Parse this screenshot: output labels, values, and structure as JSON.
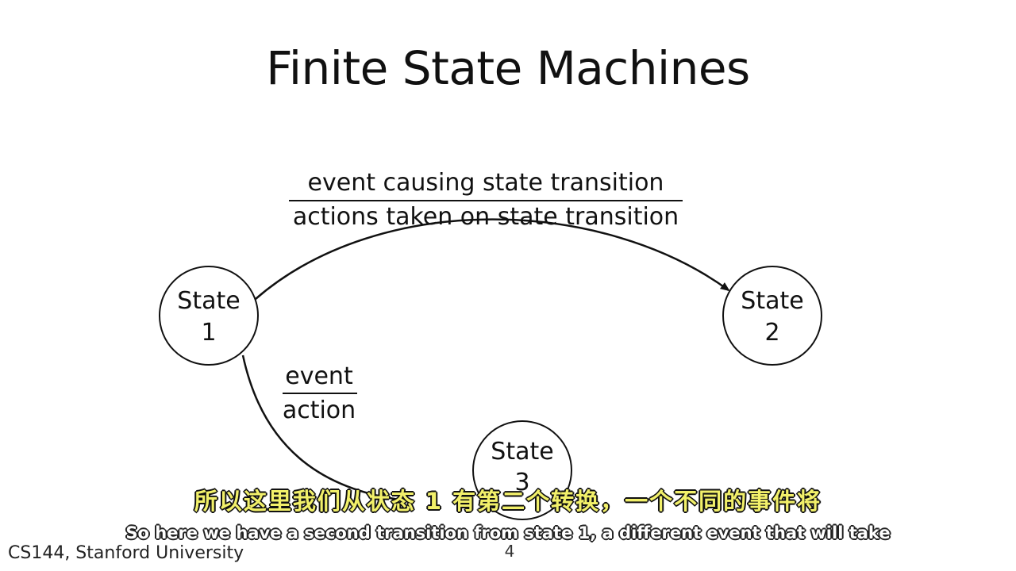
{
  "slide": {
    "title": "Finite State Machines",
    "footer": "CS144, Stanford University",
    "page_number": "4"
  },
  "diagram": {
    "states": [
      {
        "line1": "State",
        "line2": "1"
      },
      {
        "line1": "State",
        "line2": "2"
      },
      {
        "line1": "State",
        "line2": "3"
      }
    ],
    "transitions": [
      {
        "from": "State 1",
        "to": "State 2",
        "event": "event causing state transition",
        "action": "actions taken on state transition"
      },
      {
        "from": "State 1",
        "to": "State 3",
        "event": "event",
        "action": "action"
      }
    ]
  },
  "subtitles": {
    "chinese": "所以这里我们从状态 1 有第二个转换，一个不同的事件将",
    "english": "So here we have a second transition from state 1, a different event that will take"
  }
}
